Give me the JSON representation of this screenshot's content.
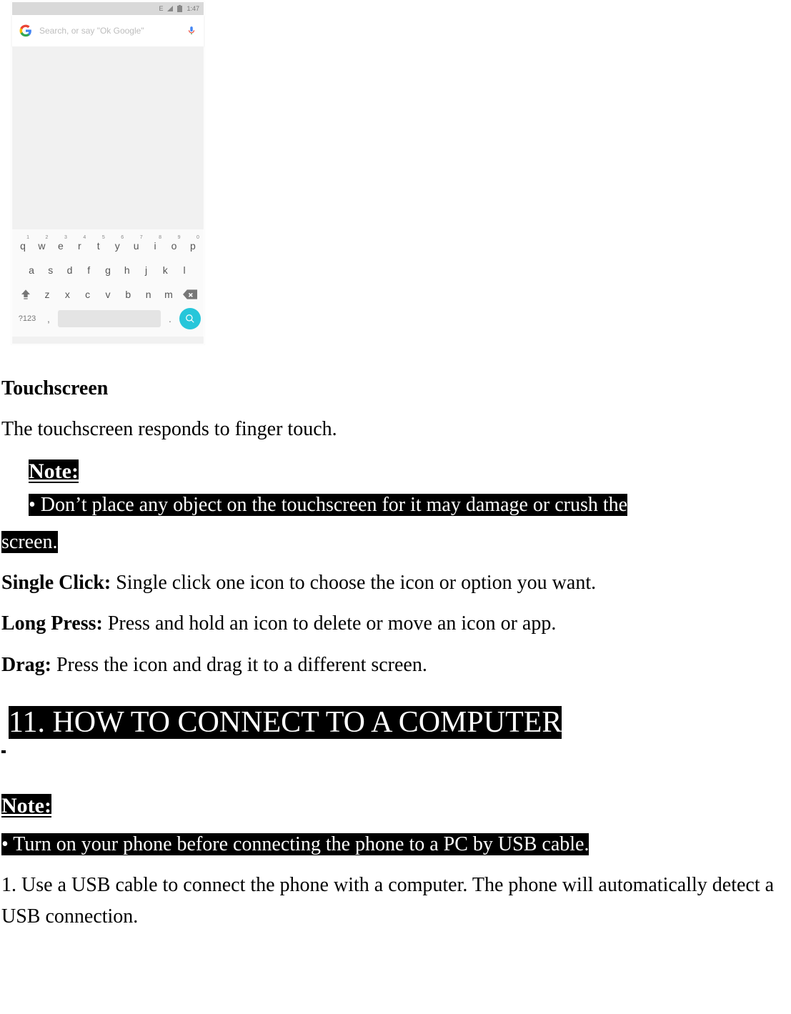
{
  "screenshot": {
    "status_bar": {
      "signal_icon": "E",
      "battery_icon": "battery",
      "time": "1:47"
    },
    "search": {
      "placeholder": "Search, or say \"Ok Google\""
    },
    "keyboard": {
      "row1": [
        {
          "k": "q",
          "n": "1"
        },
        {
          "k": "w",
          "n": "2"
        },
        {
          "k": "e",
          "n": "3"
        },
        {
          "k": "r",
          "n": "4"
        },
        {
          "k": "t",
          "n": "5"
        },
        {
          "k": "y",
          "n": "6"
        },
        {
          "k": "u",
          "n": "7"
        },
        {
          "k": "i",
          "n": "8"
        },
        {
          "k": "o",
          "n": "9"
        },
        {
          "k": "p",
          "n": "0"
        }
      ],
      "row2": [
        "a",
        "s",
        "d",
        "f",
        "g",
        "h",
        "j",
        "k",
        "l"
      ],
      "row3": [
        "z",
        "x",
        "c",
        "v",
        "b",
        "n",
        "m"
      ],
      "row4": {
        "numeric": "?123",
        "comma": ",",
        "dot": "."
      }
    }
  },
  "doc": {
    "touchscreen_heading": "Touchscreen",
    "touchscreen_intro": "The touchscreen responds to finger touch.",
    "note1_label": "Note:",
    "note1_line_a": "• Don’t place any object on the touchscreen for it may damage or crush the ",
    "note1_line_b": "screen.",
    "single_click_label": "Single Click: ",
    "single_click_text": "Single click one icon to choose the icon or option you want.",
    "long_press_label": "Long Press: ",
    "long_press_text": "Press and hold an icon to delete or move an icon or app.",
    "drag_label": "Drag: ",
    "drag_text": "Press the icon and drag it to a different screen.",
    "section_heading": "11. HOW TO CONNECT TO A COMPUTER",
    "note2_label": "Note:",
    "note2_text": "• Turn on your phone before connecting the phone to a PC by USB cable.",
    "step1": "1. Use a USB cable to connect the phone with a computer. The phone will automatically detect a USB connection."
  }
}
